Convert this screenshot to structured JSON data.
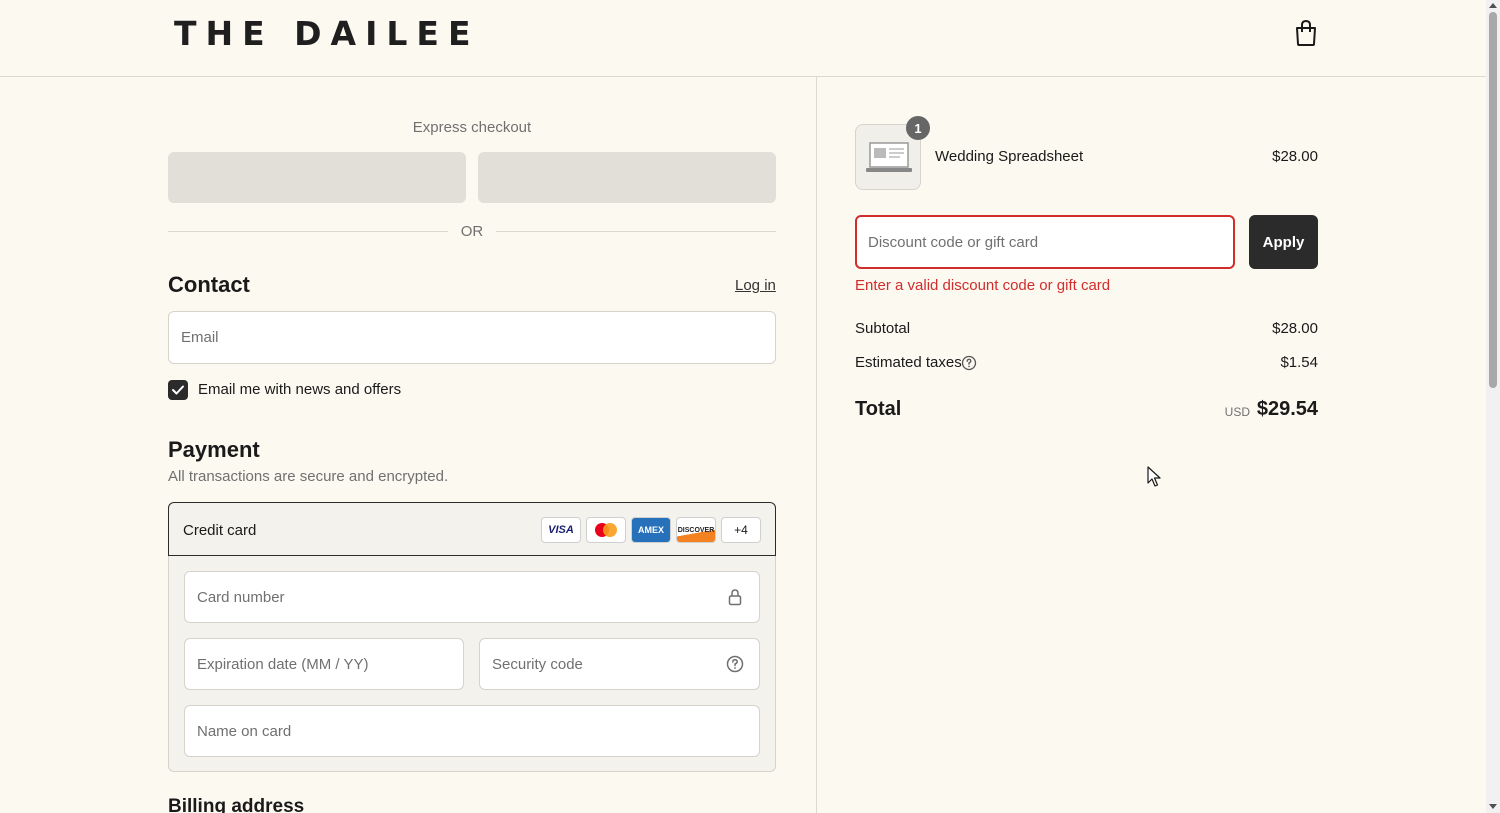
{
  "header": {
    "logo_text": "THE DAILEE",
    "cart_icon": "shopping-bag-icon"
  },
  "express_checkout": {
    "label": "Express checkout",
    "or_text": "OR"
  },
  "contact": {
    "title": "Contact",
    "login_link": "Log in",
    "email_placeholder": "Email",
    "newsletter_label": "Email me with news and offers",
    "newsletter_checked": true
  },
  "payment": {
    "title": "Payment",
    "subtitle": "All transactions are secure and encrypted.",
    "method_label": "Credit card",
    "card_logos": [
      "VISA",
      "mastercard",
      "AMEX",
      "DISCOVER"
    ],
    "more_cards": "+4",
    "card_number_placeholder": "Card number",
    "expiration_placeholder": "Expiration date (MM / YY)",
    "security_code_placeholder": "Security code",
    "name_on_card_placeholder": "Name on card"
  },
  "billing": {
    "title": "Billing address"
  },
  "order_summary": {
    "item": {
      "name": "Wedding Spreadsheet",
      "price": "$28.00",
      "quantity": "1"
    },
    "discount": {
      "placeholder": "Discount code or gift card",
      "apply_label": "Apply",
      "error": "Enter a valid discount code or gift card"
    },
    "subtotal_label": "Subtotal",
    "subtotal_value": "$28.00",
    "taxes_label": "Estimated taxes",
    "taxes_value": "$1.54",
    "total_label": "Total",
    "total_currency": "USD",
    "total_value": "$29.54"
  },
  "colors": {
    "background": "#fcf9f1",
    "error": "#d12d2d",
    "button_dark": "#2b2b2b"
  }
}
